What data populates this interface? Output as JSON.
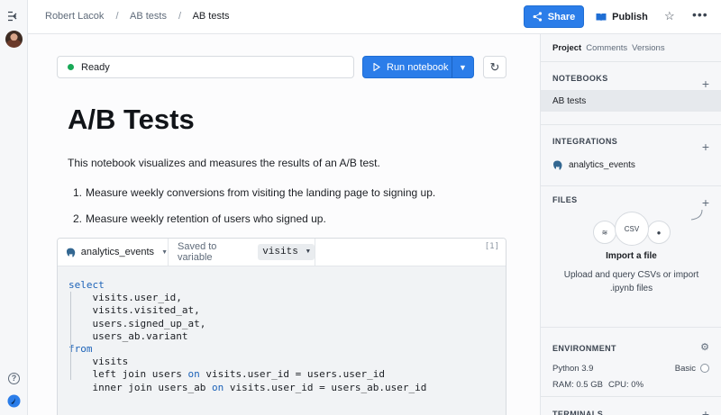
{
  "breadcrumb": {
    "user": "Robert Lacok",
    "project": "AB tests",
    "current": "AB tests",
    "separator": "/"
  },
  "toolbar": {
    "share_label": "Share",
    "publish_label": "Publish"
  },
  "notebook": {
    "status_text": "Ready",
    "run_label": "Run notebook",
    "title": "A/B Tests",
    "intro": "This notebook visualizes and measures the results of an A/B test.",
    "list": [
      {
        "num": "1.",
        "text": "Measure weekly conversions from visiting the landing page to signing up."
      },
      {
        "num": "2.",
        "text": "Measure weekly retention of users who signed up."
      }
    ]
  },
  "sql_cell": {
    "source": "analytics_events",
    "saved_label": "Saved to variable",
    "variable": "visits",
    "index": "[1]"
  },
  "panel": {
    "tabs": [
      "Project",
      "Comments",
      "Versions"
    ],
    "notebooks_title": "NOTEBOOKS",
    "notebooks": [
      "AB tests"
    ],
    "integrations_title": "INTEGRATIONS",
    "integrations": [
      "analytics_events"
    ],
    "files_title": "FILES",
    "file_icon_csv": "CSV",
    "import_title": "Import a file",
    "import_desc": "Upload and query CSVs or import .ipynb files",
    "environment_title": "ENVIRONMENT",
    "python": "Python 3.9",
    "tier": "Basic",
    "ram": "RAM: 0.5 GB",
    "cpu": "CPU: 0%",
    "terminals_title": "TERMINALS"
  },
  "colors": {
    "accent": "#2b7de9",
    "status_ok": "#18a957",
    "keyword": "#1d63b8"
  }
}
